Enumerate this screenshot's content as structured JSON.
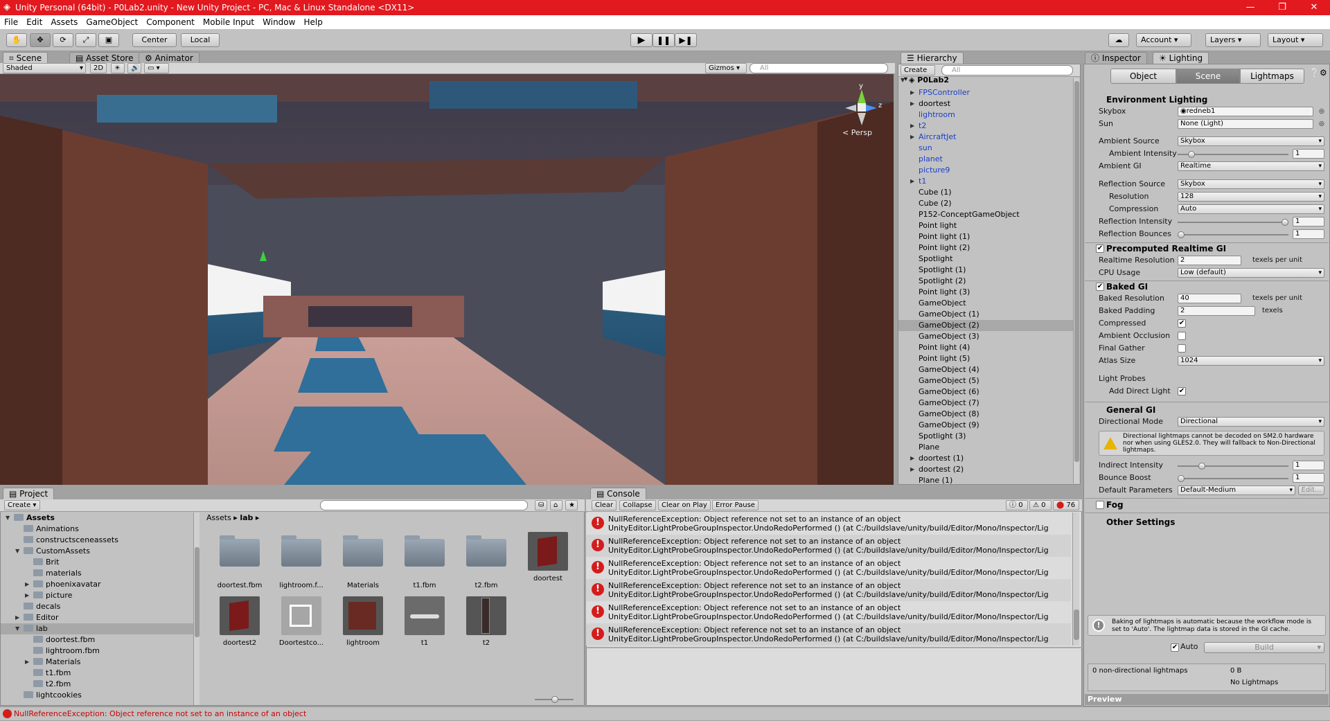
{
  "window": {
    "title": "Unity Personal (64bit) - P0Lab2.unity - New Unity Project - PC, Mac & Linux Standalone <DX11>"
  },
  "menu": [
    "File",
    "Edit",
    "Assets",
    "GameObject",
    "Component",
    "Mobile Input",
    "Window",
    "Help"
  ],
  "toolbar": {
    "pivot": "Center",
    "space": "Local",
    "account": "Account",
    "layers": "Layers",
    "layout": "Layout"
  },
  "scene_panel": {
    "tabs": [
      "Scene",
      "Asset Store",
      "Animator"
    ],
    "shading": "Shaded",
    "mode2d": "2D",
    "gizmos": "Gizmos",
    "search_placeholder": "All",
    "persp": "< Persp",
    "axis_y": "y",
    "axis_z": "z"
  },
  "hierarchy": {
    "tab": "Hierarchy",
    "create": "Create",
    "search_placeholder": "All",
    "scene": "P0Lab2",
    "items": [
      {
        "label": "FPSController",
        "blue": true,
        "arrow": true
      },
      {
        "label": "doortest",
        "blue": false,
        "arrow": true
      },
      {
        "label": "lightroom",
        "blue": true,
        "arrow": false
      },
      {
        "label": "t2",
        "blue": true,
        "arrow": true
      },
      {
        "label": "AircraftJet",
        "blue": true,
        "arrow": true
      },
      {
        "label": "sun",
        "blue": true,
        "arrow": false
      },
      {
        "label": "planet",
        "blue": true,
        "arrow": false
      },
      {
        "label": "picture9",
        "blue": true,
        "arrow": false
      },
      {
        "label": "t1",
        "blue": true,
        "arrow": true
      },
      {
        "label": "Cube (1)",
        "blue": false,
        "arrow": false
      },
      {
        "label": "Cube (2)",
        "blue": false,
        "arrow": false
      },
      {
        "label": "P152-ConceptGameObject",
        "blue": false,
        "arrow": false
      },
      {
        "label": "Point light",
        "blue": false,
        "arrow": false
      },
      {
        "label": "Point light (1)",
        "blue": false,
        "arrow": false
      },
      {
        "label": "Point light (2)",
        "blue": false,
        "arrow": false
      },
      {
        "label": "Spotlight",
        "blue": false,
        "arrow": false
      },
      {
        "label": "Spotlight (1)",
        "blue": false,
        "arrow": false
      },
      {
        "label": "Spotlight (2)",
        "blue": false,
        "arrow": false
      },
      {
        "label": "Point light (3)",
        "blue": false,
        "arrow": false
      },
      {
        "label": "GameObject",
        "blue": false,
        "arrow": false
      },
      {
        "label": "GameObject (1)",
        "blue": false,
        "arrow": false
      },
      {
        "label": "GameObject (2)",
        "blue": false,
        "arrow": false
      },
      {
        "label": "GameObject (3)",
        "blue": false,
        "arrow": false
      },
      {
        "label": "Point light (4)",
        "blue": false,
        "arrow": false
      },
      {
        "label": "Point light (5)",
        "blue": false,
        "arrow": false
      },
      {
        "label": "GameObject (4)",
        "blue": false,
        "arrow": false
      },
      {
        "label": "GameObject (5)",
        "blue": false,
        "arrow": false
      },
      {
        "label": "GameObject (6)",
        "blue": false,
        "arrow": false
      },
      {
        "label": "GameObject (7)",
        "blue": false,
        "arrow": false
      },
      {
        "label": "GameObject (8)",
        "blue": false,
        "arrow": false
      },
      {
        "label": "GameObject (9)",
        "blue": false,
        "arrow": false
      },
      {
        "label": "Spotlight (3)",
        "blue": false,
        "arrow": false
      },
      {
        "label": "Plane",
        "blue": false,
        "arrow": false
      },
      {
        "label": "doortest (1)",
        "blue": false,
        "arrow": true
      },
      {
        "label": "doortest (2)",
        "blue": false,
        "arrow": true
      },
      {
        "label": "Plane (1)",
        "blue": false,
        "arrow": false
      }
    ],
    "selected": "GameObject (2)"
  },
  "inspector": {
    "tabs": [
      "Inspector",
      "Lighting"
    ],
    "subtabs": [
      "Object",
      "Scene",
      "Lightmaps"
    ],
    "env_header": "Environment Lighting",
    "skybox_label": "Skybox",
    "skybox_value": "redneb1",
    "sun_label": "Sun",
    "sun_value": "None (Light)",
    "ambient_source_label": "Ambient Source",
    "ambient_source_value": "Skybox",
    "ambient_intensity_label": "Ambient Intensity",
    "ambient_intensity_value": "1",
    "ambient_gi_label": "Ambient GI",
    "ambient_gi_value": "Realtime",
    "reflection_source_label": "Reflection Source",
    "reflection_source_value": "Skybox",
    "resolution_label": "Resolution",
    "resolution_value": "128",
    "compression_label": "Compression",
    "compression_value": "Auto",
    "reflection_intensity_label": "Reflection Intensity",
    "reflection_intensity_value": "1",
    "reflection_bounces_label": "Reflection Bounces",
    "reflection_bounces_value": "1",
    "precomputed_header": "Precomputed Realtime GI",
    "realtime_res_label": "Realtime Resolution",
    "realtime_res_value": "2",
    "texels_per_unit": "texels per unit",
    "cpu_usage_label": "CPU Usage",
    "cpu_usage_value": "Low (default)",
    "baked_header": "Baked GI",
    "baked_res_label": "Baked Resolution",
    "baked_res_value": "40",
    "baked_padding_label": "Baked Padding",
    "baked_padding_value": "2",
    "texels": "texels",
    "compressed_label": "Compressed",
    "ambient_occlusion_label": "Ambient Occlusion",
    "final_gather_label": "Final Gather",
    "atlas_size_label": "Atlas Size",
    "atlas_size_value": "1024",
    "light_probes_label": "Light Probes",
    "add_direct_light_label": "Add Direct Light",
    "general_header": "General GI",
    "directional_mode_label": "Directional Mode",
    "directional_mode_value": "Directional",
    "warning_text": "Directional lightmaps cannot be decoded on SM2.0 hardware nor when using GLES2.0. They will fallback to Non-Directional lightmaps.",
    "indirect_intensity_label": "Indirect Intensity",
    "indirect_intensity_value": "1",
    "bounce_boost_label": "Bounce Boost",
    "bounce_boost_value": "1",
    "default_params_label": "Default Parameters",
    "default_params_value": "Default-Medium",
    "edit_label": "Edit...",
    "fog_label": "Fog",
    "other_settings_header": "Other Settings",
    "info_text": "Baking of lightmaps is automatic because the workflow mode is set to 'Auto'. The lightmap data is stored in the GI cache.",
    "auto_label": "Auto",
    "build_label": "Build",
    "lightmaps_count": "0 non-directional lightmaps",
    "lightmaps_size": "0 B",
    "no_lightmaps": "No Lightmaps",
    "preview": "Preview",
    "ambient_intensity_level": 0.1,
    "reflection_intensity_level": 1.0,
    "reflection_bounces_level": 0.0,
    "indirect_intensity_level": 0.2,
    "bounce_boost_level": 0.0
  },
  "project": {
    "tab": "Project",
    "create": "Create",
    "breadcrumb_root": "Assets",
    "breadcrumb_leaf": "lab",
    "tree": [
      {
        "label": "Assets",
        "depth": 0,
        "bold": true,
        "arrow": "down"
      },
      {
        "label": "Animations",
        "depth": 1,
        "arrow": ""
      },
      {
        "label": "constructsceneassets",
        "depth": 1,
        "arrow": ""
      },
      {
        "label": "CustomAssets",
        "depth": 1,
        "arrow": "down"
      },
      {
        "label": "Brit",
        "depth": 2,
        "arrow": ""
      },
      {
        "label": "materials",
        "depth": 2,
        "arrow": ""
      },
      {
        "label": "phoenixavatar",
        "depth": 2,
        "arrow": "right"
      },
      {
        "label": "picture",
        "depth": 2,
        "arrow": "right"
      },
      {
        "label": "decals",
        "depth": 1,
        "arrow": ""
      },
      {
        "label": "Editor",
        "depth": 1,
        "arrow": "right"
      },
      {
        "label": "lab",
        "depth": 1,
        "arrow": "down",
        "selected": true
      },
      {
        "label": "doortest.fbm",
        "depth": 2,
        "arrow": ""
      },
      {
        "label": "lightroom.fbm",
        "depth": 2,
        "arrow": ""
      },
      {
        "label": "Materials",
        "depth": 2,
        "arrow": "right"
      },
      {
        "label": "t1.fbm",
        "depth": 2,
        "arrow": ""
      },
      {
        "label": "t2.fbm",
        "depth": 2,
        "arrow": ""
      },
      {
        "label": "lightcookies",
        "depth": 1,
        "arrow": ""
      }
    ],
    "assets": [
      {
        "label": "doortest.fbm",
        "kind": "folder"
      },
      {
        "label": "lightroom.f...",
        "kind": "folder"
      },
      {
        "label": "Materials",
        "kind": "folder"
      },
      {
        "label": "t1.fbm",
        "kind": "folder"
      },
      {
        "label": "t2.fbm",
        "kind": "folder"
      },
      {
        "label": "doortest",
        "kind": "model"
      },
      {
        "label": "doortest2",
        "kind": "model"
      },
      {
        "label": "Doortestco...",
        "kind": "prefab"
      },
      {
        "label": "lightroom",
        "kind": "cube"
      },
      {
        "label": "t1",
        "kind": "jet"
      },
      {
        "label": "t2",
        "kind": "tall"
      }
    ]
  },
  "console": {
    "tab": "Console",
    "buttons": [
      "Clear",
      "Collapse",
      "Clear on Play",
      "Error Pause"
    ],
    "info_count": "0",
    "warn_count": "0",
    "error_count": "76",
    "line1": "NullReferenceException: Object reference not set to an instance of an object",
    "line2": "UnityEditor.LightProbeGroupInspector.UndoRedoPerformed () (at C:/buildslave/unity/build/Editor/Mono/Inspector/Lig",
    "rows": 6
  },
  "status": "NullReferenceException: Object reference not set to an instance of an object",
  "colors": {
    "titlebar": "#e2191f",
    "error": "#d41c1c",
    "hier_blue": "#1b3fc8"
  }
}
